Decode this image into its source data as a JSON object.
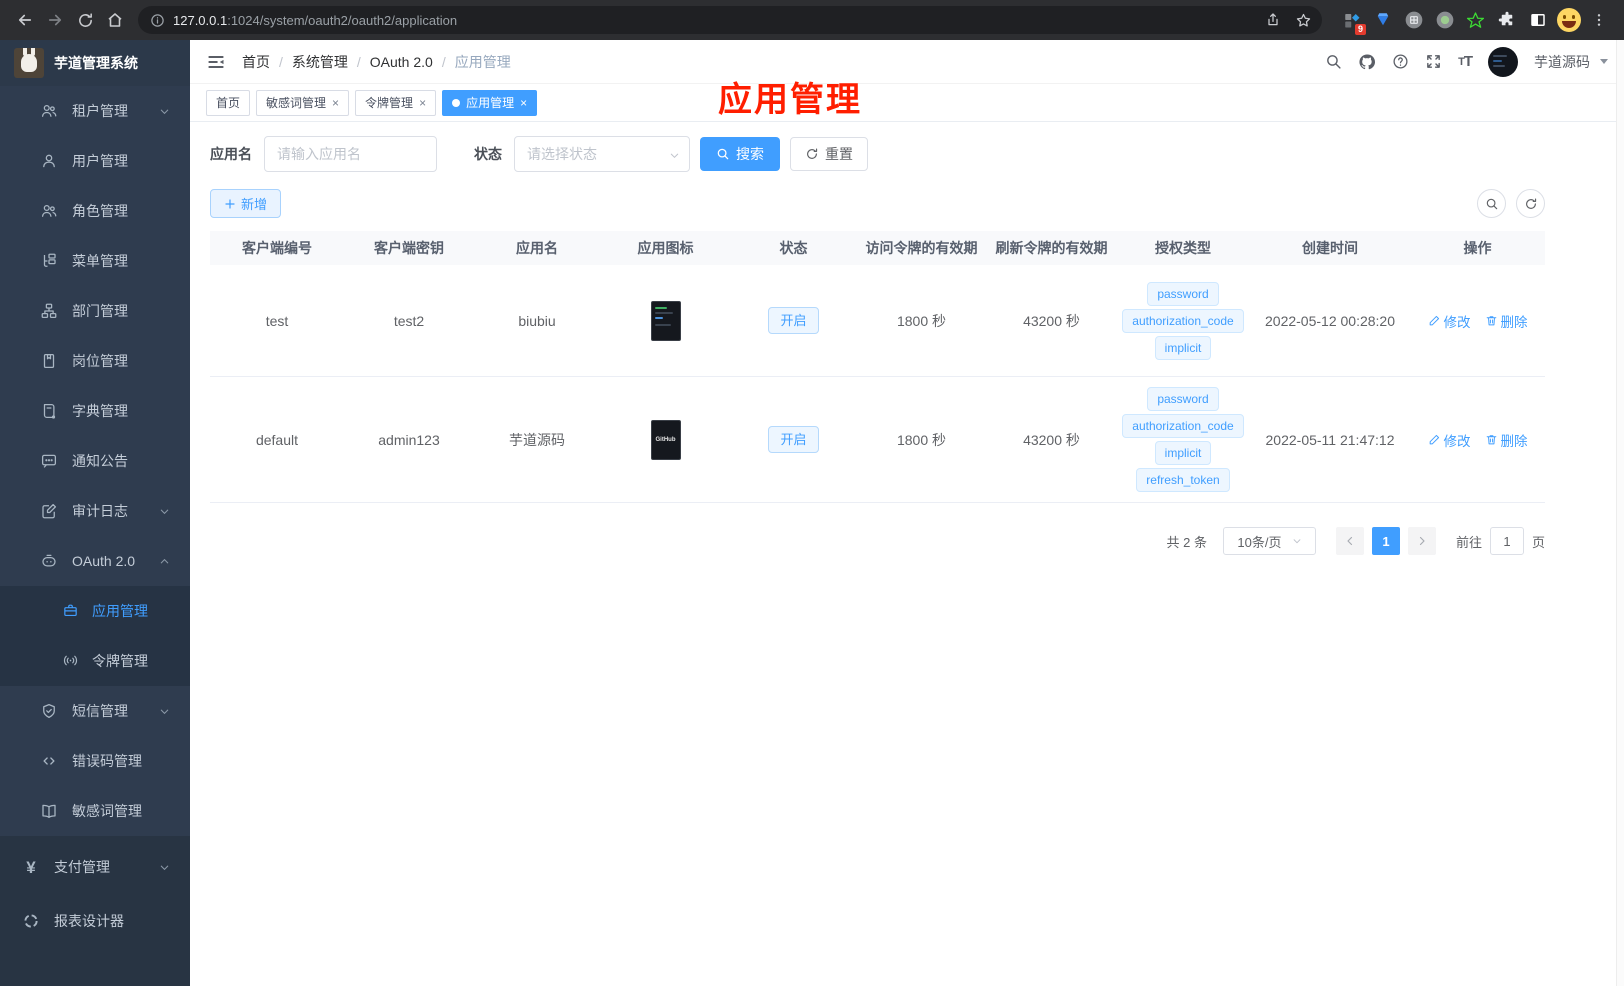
{
  "browser": {
    "url_host": "127.0.0.1",
    "url_rest": ":1024/system/oauth2/oauth2/application",
    "extension_badge": "9"
  },
  "sidebar": {
    "title": "芋道管理系统",
    "items": [
      {
        "label": "租户管理"
      },
      {
        "label": "用户管理"
      },
      {
        "label": "角色管理"
      },
      {
        "label": "菜单管理"
      },
      {
        "label": "部门管理"
      },
      {
        "label": "岗位管理"
      },
      {
        "label": "字典管理"
      },
      {
        "label": "通知公告"
      },
      {
        "label": "审计日志"
      },
      {
        "label": "OAuth 2.0"
      },
      {
        "label": "应用管理"
      },
      {
        "label": "令牌管理"
      },
      {
        "label": "短信管理"
      },
      {
        "label": "错误码管理"
      },
      {
        "label": "敏感词管理"
      },
      {
        "label": "支付管理"
      },
      {
        "label": "报表设计器"
      }
    ]
  },
  "header": {
    "breadcrumb": [
      "首页",
      "系统管理",
      "OAuth 2.0",
      "应用管理"
    ],
    "separator": "/",
    "username": "芋道源码"
  },
  "tabs": [
    {
      "label": "首页"
    },
    {
      "label": "敏感词管理"
    },
    {
      "label": "令牌管理"
    },
    {
      "label": "应用管理"
    }
  ],
  "annotation": {
    "text": "应用管理",
    "color": "#ff1e00"
  },
  "filters": {
    "name_label": "应用名",
    "name_placeholder": "请输入应用名",
    "status_label": "状态",
    "status_placeholder": "请选择状态",
    "search_label": "搜索",
    "reset_label": "重置"
  },
  "toolbar": {
    "add_label": "新增"
  },
  "table": {
    "columns": [
      "客户端编号",
      "客户端密钥",
      "应用名",
      "应用图标",
      "状态",
      "访问令牌的有效期",
      "刷新令牌的有效期",
      "授权类型",
      "创建时间",
      "操作"
    ],
    "edit_label": "修改",
    "delete_label": "删除",
    "rows": [
      {
        "client_id": "test",
        "client_secret": "test2",
        "app_name": "biubiu",
        "status": "开启",
        "access_validity": "1800 秒",
        "refresh_validity": "43200 秒",
        "grants": [
          "password",
          "authorization_code",
          "implicit"
        ],
        "created_at": "2022-05-12 00:28:20"
      },
      {
        "client_id": "default",
        "client_secret": "admin123",
        "app_name": "芋道源码",
        "status": "开启",
        "access_validity": "1800 秒",
        "refresh_validity": "43200 秒",
        "grants": [
          "password",
          "authorization_code",
          "implicit",
          "refresh_token"
        ],
        "created_at": "2022-05-11 21:47:12",
        "thumb_text": "GitHub"
      }
    ]
  },
  "pagination": {
    "total": "共 2 条",
    "page_size": "10条/页",
    "current_page": "1",
    "goto_label": "前往",
    "page_unit": "页",
    "goto_value": "1"
  },
  "colors": {
    "accent": "#409eff",
    "annotation": "#ff1e00",
    "sidebar_bg": "#2f3c4f"
  }
}
